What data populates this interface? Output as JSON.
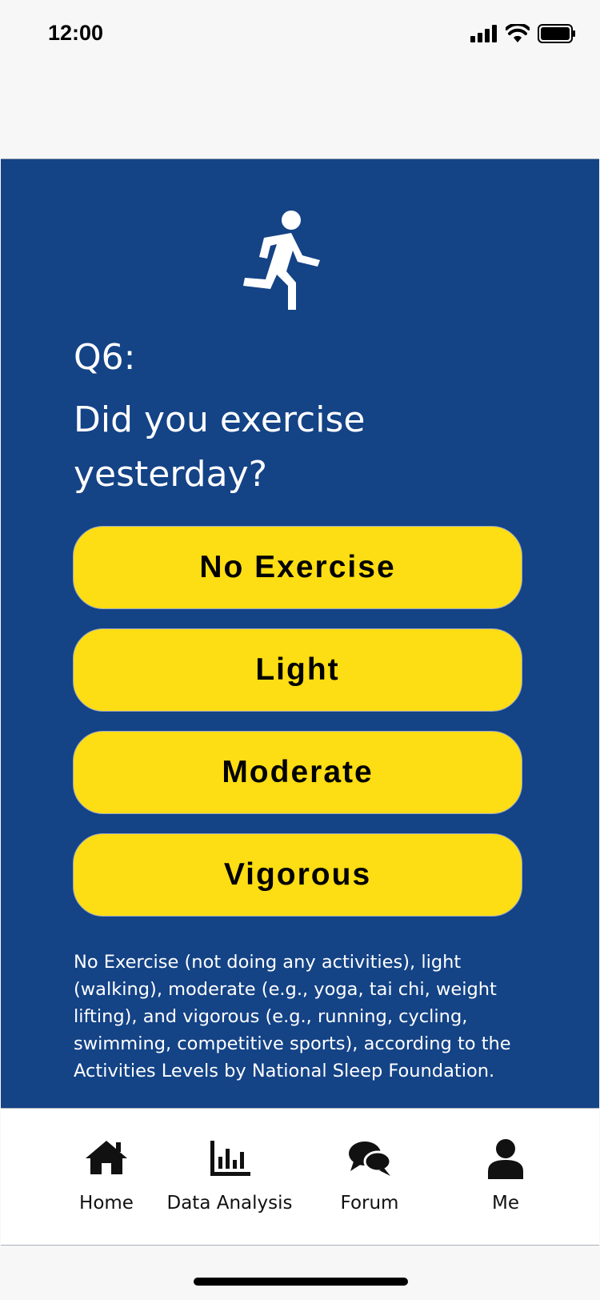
{
  "status": {
    "time": "12:00"
  },
  "question": {
    "number": "Q6:",
    "text": "Did you exercise yesterday?"
  },
  "options": [
    "No Exercise",
    "Light",
    "Moderate",
    "Vigorous"
  ],
  "note": "No Exercise (not doing any activities), light (walking), moderate (e.g., yoga, tai chi, weight lifting), and vigorous (e.g., running, cycling, swimming, competitive sports), according to the Activities Levels by National Sleep Foundation.",
  "tabs": [
    {
      "label": "Home",
      "icon": "home-icon"
    },
    {
      "label": "Data Analysis",
      "icon": "bar-chart-icon"
    },
    {
      "label": "Forum",
      "icon": "chat-bubbles-icon"
    },
    {
      "label": "Me",
      "icon": "user-icon"
    }
  ],
  "colors": {
    "panel": "#144386",
    "option": "#fddd13",
    "background": "#f7f7f7"
  }
}
